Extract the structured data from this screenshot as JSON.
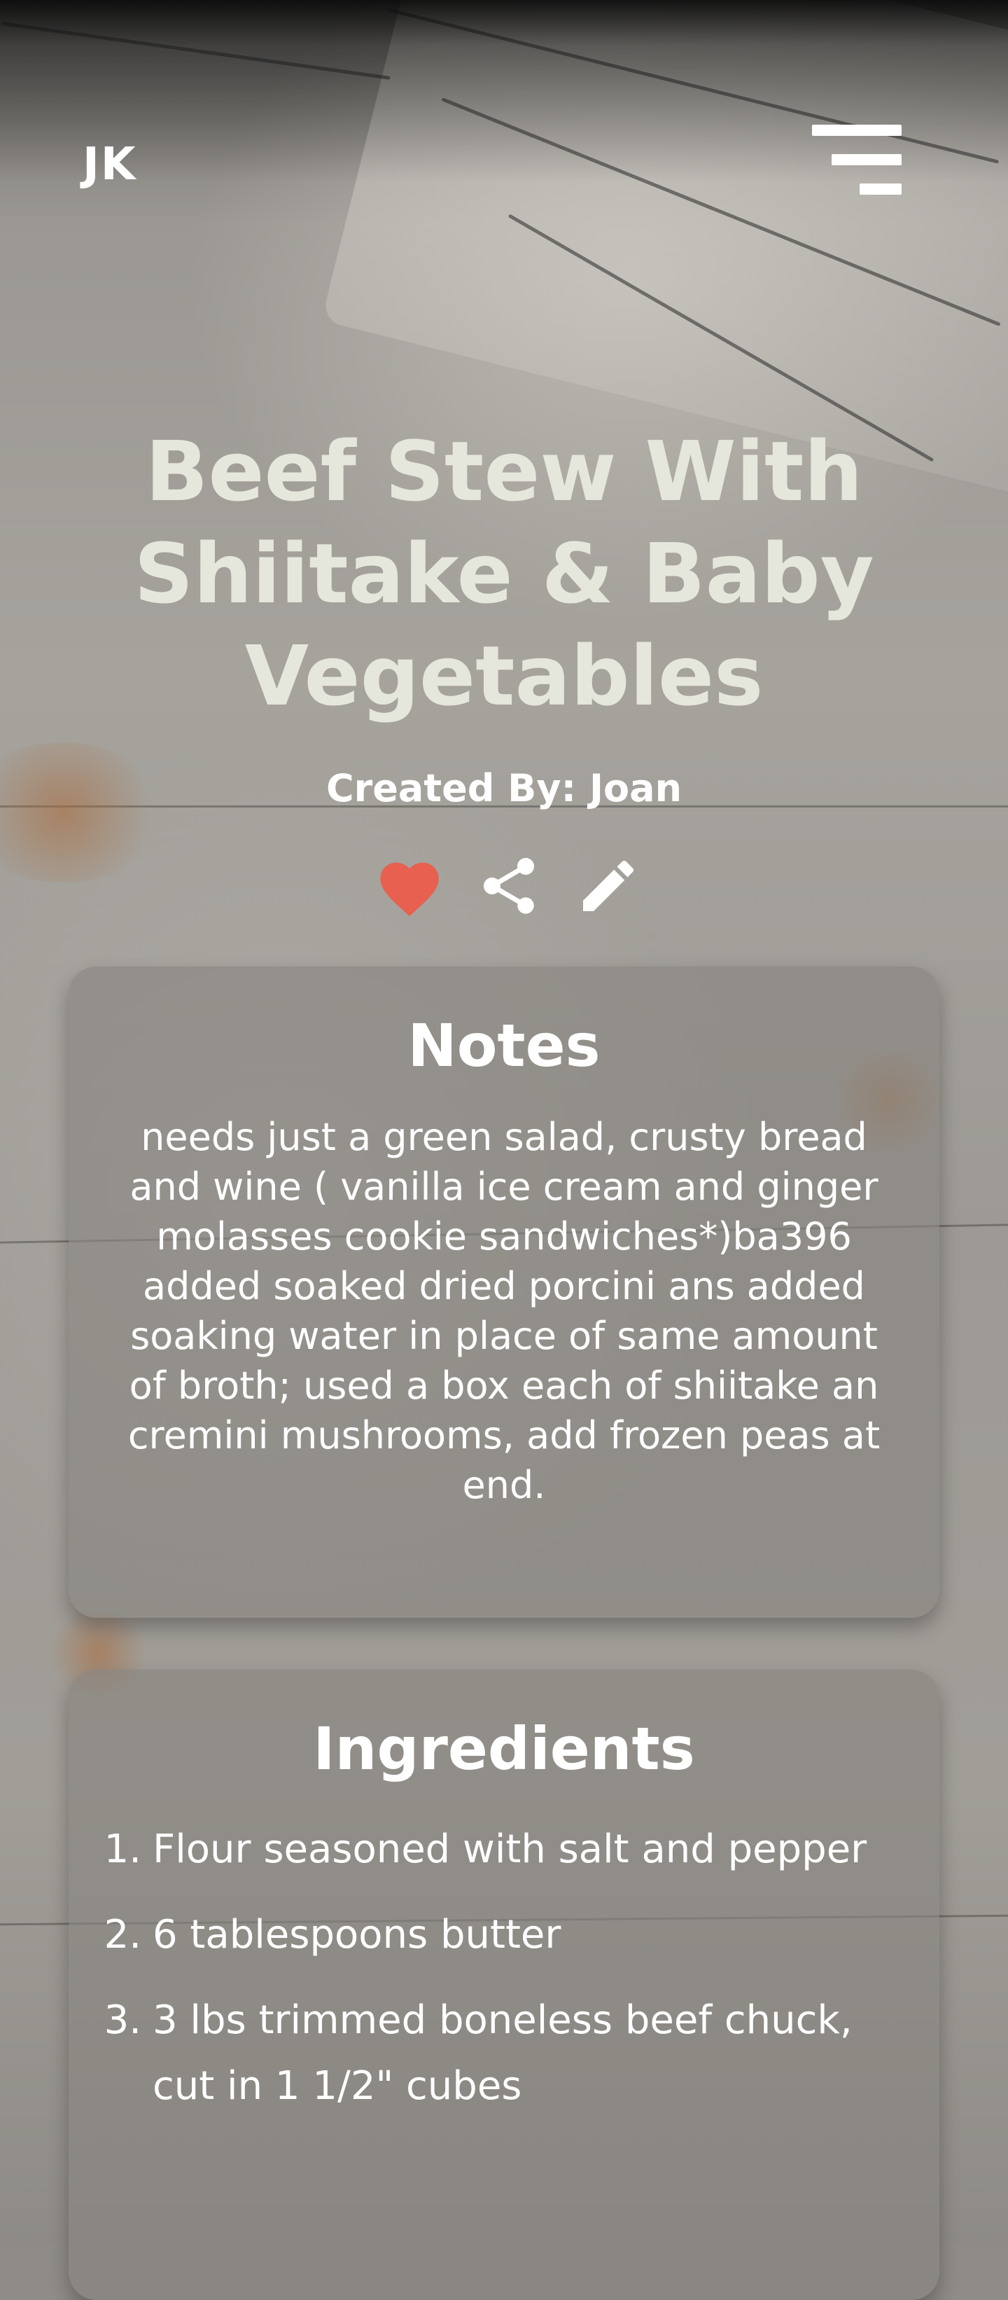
{
  "header": {
    "logo_text": "JK",
    "menu_icon": "menu-icon"
  },
  "recipe": {
    "title": "Beef Stew With Shiitake & Baby Vegetables",
    "created_by": "Created By: Joan",
    "actions": [
      {
        "icon": "heart-icon",
        "color": "#e8604f"
      },
      {
        "icon": "share-icon",
        "color": "#ffffff"
      },
      {
        "icon": "pencil-icon",
        "color": "#ffffff"
      }
    ]
  },
  "notes": {
    "title": "Notes",
    "text": "needs just a green salad, crusty bread and wine ( vanilla ice cream and ginger molasses cookie sandwiches*)ba396 added soaked dried porcini ans added soaking water in place of same amount of broth; used a box each of shiitake an cremini mushrooms, add frozen peas at end."
  },
  "ingredients": {
    "title": "Ingredients",
    "items": [
      {
        "num": "1.",
        "text": "Flour seasoned with salt and pepper"
      },
      {
        "num": "2.",
        "text": "6 tablespoons butter"
      },
      {
        "num": "3.",
        "text": "3 lbs trimmed boneless beef chuck, cut in 1 1/2\" cubes"
      }
    ]
  },
  "colors": {
    "title_color": "#e5e7dc",
    "heart": "#e8604f",
    "card_bg": "rgba(135,132,128,0.62)"
  }
}
